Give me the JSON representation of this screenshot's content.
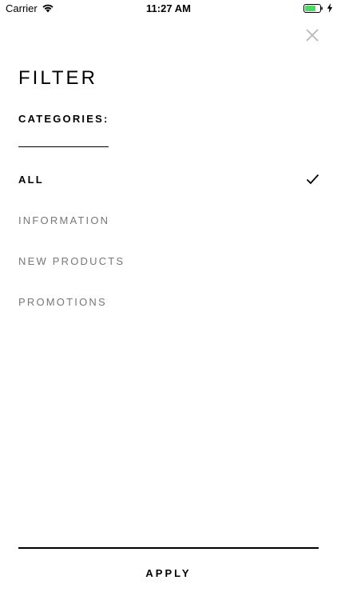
{
  "status_bar": {
    "carrier": "Carrier",
    "time": "11:27 AM",
    "battery_color": "#4cd964"
  },
  "header": {
    "title": "FILTER",
    "close_icon": "close-icon"
  },
  "section": {
    "label": "CATEGORIES:"
  },
  "categories": [
    {
      "label": "ALL",
      "selected": true
    },
    {
      "label": "INFORMATION",
      "selected": false
    },
    {
      "label": "NEW PRODUCTS",
      "selected": false
    },
    {
      "label": "PROMOTIONS",
      "selected": false
    }
  ],
  "footer": {
    "apply_label": "APPLY"
  }
}
